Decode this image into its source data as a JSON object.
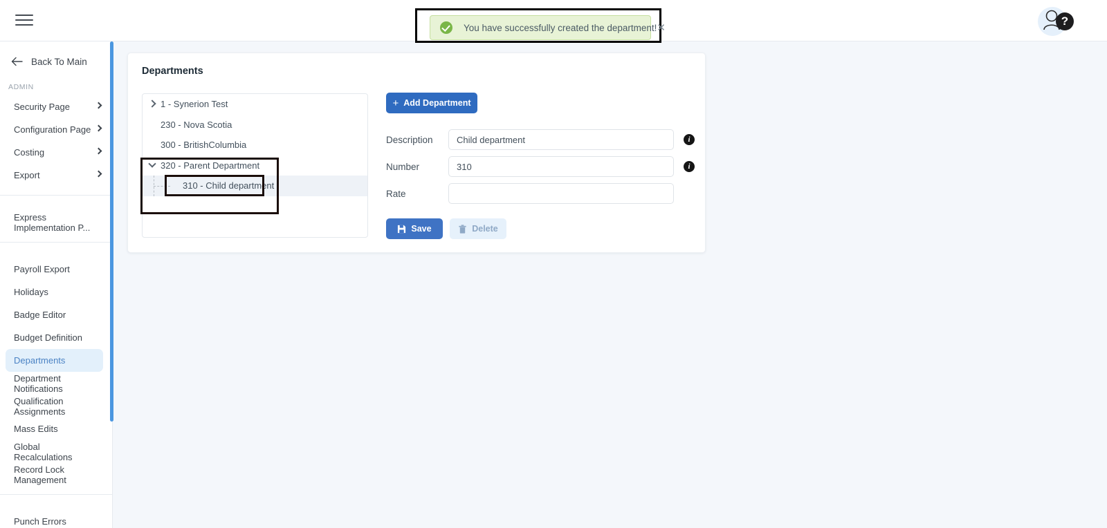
{
  "topbar": {
    "menu_icon": "hamburger-icon",
    "avatar_icon": "user-avatar-icon",
    "help_label": "?"
  },
  "toast": {
    "message": "You have successfully created the department!",
    "close_label": "✕",
    "status_icon": "success-check-icon",
    "bg_color": "#e8f3d6",
    "border_color": "#c6dfa0",
    "accent_color": "#7ab648"
  },
  "sidebar": {
    "back_label": "Back To Main",
    "section_label": "ADMIN",
    "expandable": [
      {
        "label": "Security Page"
      },
      {
        "label": "Configuration Page"
      },
      {
        "label": "Costing"
      },
      {
        "label": "Export"
      }
    ],
    "group_express": [
      {
        "label": "Express Implementation P..."
      }
    ],
    "items": [
      {
        "label": "Payroll Export",
        "selected": false
      },
      {
        "label": "Holidays",
        "selected": false
      },
      {
        "label": "Badge Editor",
        "selected": false
      },
      {
        "label": "Budget Definition",
        "selected": false
      },
      {
        "label": "Departments",
        "selected": true
      },
      {
        "label": "Department Notifications",
        "selected": false
      },
      {
        "label": "Qualification Assignments",
        "selected": false
      },
      {
        "label": "Mass Edits",
        "selected": false
      },
      {
        "label": "Global Recalculations",
        "selected": false
      },
      {
        "label": "Record Lock Management",
        "selected": false
      }
    ],
    "bottom_items": [
      {
        "label": "Punch Errors"
      }
    ],
    "selected_bg": "#e3f0fb",
    "selected_fg": "#4a82c4",
    "scrollbar_color": "#4b97e0"
  },
  "card": {
    "title": "Departments"
  },
  "tree": {
    "nodes": [
      {
        "label": "1 - Synerion Test",
        "level": 0,
        "toggle": "closed",
        "highlight": false
      },
      {
        "label": "230 - Nova Scotia",
        "level": 0,
        "toggle": "none",
        "highlight": false
      },
      {
        "label": "300 - BritishColumbia",
        "level": 0,
        "toggle": "none",
        "highlight": false
      },
      {
        "label": "320 - Parent Department",
        "level": 0,
        "toggle": "open",
        "highlight": false
      },
      {
        "label": "310 - Child department",
        "level": 1,
        "toggle": "none",
        "highlight": true
      }
    ],
    "highlight_color": "#eef2f7"
  },
  "form": {
    "add_button": "Add Department",
    "add_icon": "plus-icon",
    "fields": [
      {
        "label": "Description",
        "value": "Child department",
        "placeholder": "",
        "info": true
      },
      {
        "label": "Number",
        "value": "310",
        "placeholder": "",
        "info": true
      },
      {
        "label": "Rate",
        "value": "",
        "placeholder": "",
        "info": false
      }
    ],
    "save_label": "Save",
    "save_icon": "save-disk-icon",
    "delete_label": "Delete",
    "delete_icon": "trash-icon",
    "primary_color": "#2f6bc0",
    "save_color": "#3f73c4",
    "delete_bg": "#e6f1fb"
  }
}
